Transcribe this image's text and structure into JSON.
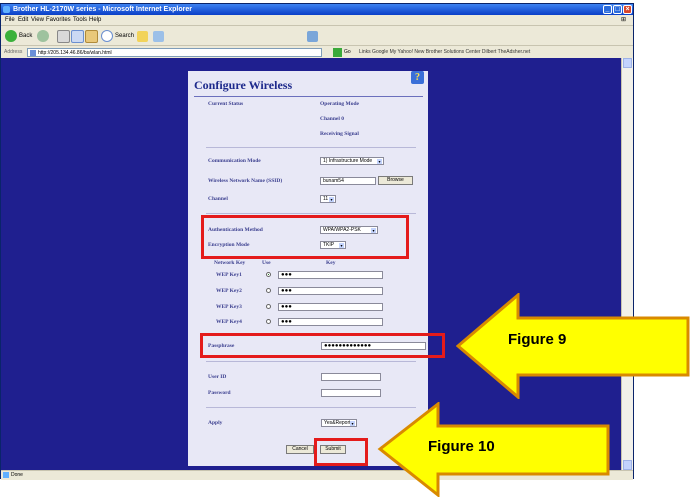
{
  "window": {
    "title": "Brother HL-2170W series - Microsoft Internet Explorer"
  },
  "menu": [
    "File",
    "Edit",
    "View",
    "Favorites",
    "Tools",
    "Help"
  ],
  "toolbar": {
    "back_label": "Back",
    "search_label": "Search"
  },
  "address": {
    "label": "Address",
    "url": "http://205.134.46.86/bs/wlan.html",
    "go_label": "Go",
    "links": "Links  Google  My Yahoo!  New Brother Solutions Center  Dilbert  TheAdsher.net"
  },
  "status": {
    "text": "Done"
  },
  "page": {
    "title": "Configure Wireless",
    "help_glyph": "?",
    "current_status": {
      "label": "Current Status",
      "operating_mode": "Operating Mode",
      "channel": "Channel  0",
      "receiving_signal": "Receiving Signal"
    },
    "communication_mode": {
      "label": "Communication Mode",
      "value": "1) Infrastructure Mode"
    },
    "ssid": {
      "label": "Wireless Network Name (SSID)",
      "value": "bunam54",
      "browse": "Browse"
    },
    "channel": {
      "label": "Channel",
      "value": "11"
    },
    "auth": {
      "label": "Authentication Method",
      "value": "WPA/WPA2-PSK"
    },
    "encryption": {
      "label": "Encryption Mode",
      "value": "TKIP"
    },
    "wep": {
      "col_key": "Network Key",
      "col_use": "Use",
      "col_keyval": "Key",
      "keys": [
        {
          "label": "WEP Key1",
          "value": "●●●",
          "selected": true
        },
        {
          "label": "WEP Key2",
          "value": "●●●",
          "selected": false
        },
        {
          "label": "WEP Key3",
          "value": "●●●",
          "selected": false
        },
        {
          "label": "WEP Key4",
          "value": "●●●",
          "selected": false
        }
      ]
    },
    "passphrase": {
      "label": "Passphrase",
      "value": "●●●●●●●●●●●●●"
    },
    "user_id": {
      "label": "User ID",
      "value": ""
    },
    "password": {
      "label": "Password",
      "value": ""
    },
    "apply": {
      "label": "Apply",
      "value": "Yes&Report"
    },
    "cancel_label": "Cancel",
    "submit_label": "Submit"
  },
  "callouts": {
    "figure9": "Figure 9",
    "figure10": "Figure 10"
  },
  "colors": {
    "highlight": "#e41b1b",
    "callout_fill": "#ffff00",
    "page_bg": "#1f1f8f"
  }
}
